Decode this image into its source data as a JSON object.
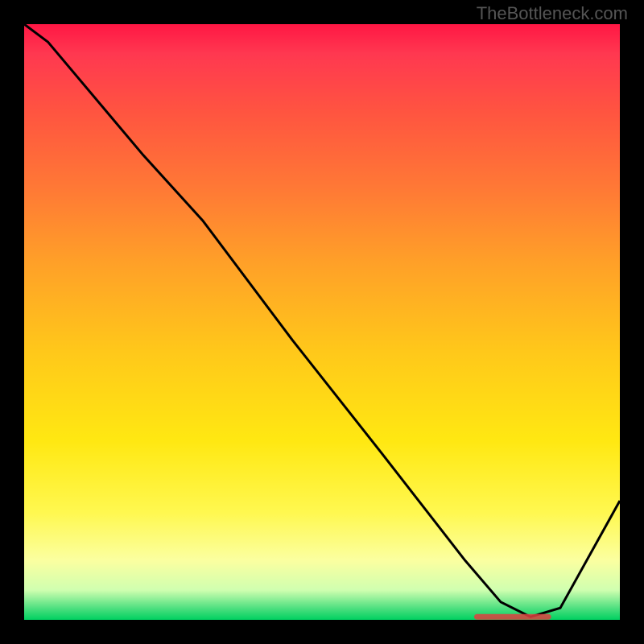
{
  "watermark": "TheBottleneck.com",
  "chart_data": {
    "type": "line",
    "title": "",
    "xlabel": "",
    "ylabel": "",
    "xlim": [
      0,
      100
    ],
    "ylim": [
      0,
      100
    ],
    "bg_gradient": {
      "top_color": "#ff1744",
      "mid_color": "#ffe812",
      "bottom_color": "#00d060",
      "description": "vertical red-to-yellow-to-green gradient (bottleneck severity: red=high, green=optimal)"
    },
    "series": [
      {
        "name": "bottleneck-curve",
        "x": [
          0,
          4,
          20,
          30,
          45,
          60,
          74,
          80,
          85,
          90,
          100
        ],
        "y": [
          100,
          97,
          78,
          67,
          47,
          28,
          10,
          3,
          0.5,
          2,
          20
        ]
      }
    ],
    "annotation": {
      "name": "optimal-range-marker",
      "x_start": 76,
      "x_end": 88,
      "y": 0.5,
      "color": "#e04040"
    }
  }
}
